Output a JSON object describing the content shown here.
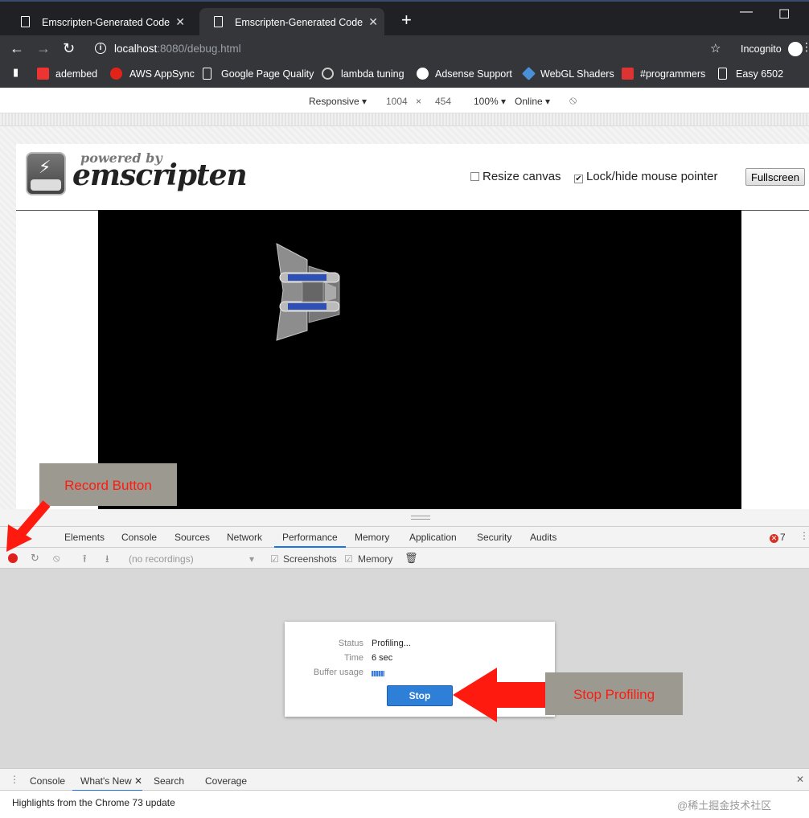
{
  "tabs": [
    {
      "title": "Emscripten-Generated Code",
      "close": "✕"
    },
    {
      "title": "Emscripten-Generated Code",
      "close": "✕"
    }
  ],
  "window": {
    "minimize": "—",
    "maximize": "☐"
  },
  "address": {
    "host": "localhost",
    "rest": ":8080/debug.html"
  },
  "incognito_label": "Incognito",
  "bookmarks": [
    "adembed",
    "AWS AppSync",
    "Google Page Quality",
    "lambda tuning",
    "Adsense Support",
    "WebGL Shaders",
    "#programmers",
    "Easy 6502"
  ],
  "device_toolbar": {
    "mode": "Responsive ▾",
    "width": "1004",
    "times": "×",
    "height": "454",
    "zoom": "100% ▾",
    "network": "Online ▾"
  },
  "page": {
    "powered_by": "powered by",
    "brand": "emscripten",
    "resize_canvas": "Resize canvas",
    "lock_pointer": "Lock/hide mouse pointer",
    "fullscreen": "Fullscreen"
  },
  "devtools": {
    "tabs": [
      "Elements",
      "Console",
      "Sources",
      "Network",
      "Performance",
      "Memory",
      "Application",
      "Security",
      "Audits"
    ],
    "selected_tab": "Performance",
    "error_count": "7",
    "recordings_placeholder": "(no recordings)",
    "screenshots": "Screenshots",
    "memory": "Memory"
  },
  "profiling": {
    "status_label": "Status",
    "status_value": "Profiling...",
    "time_label": "Time",
    "time_value": "6 sec",
    "buffer_label": "Buffer usage",
    "stop": "Stop"
  },
  "drawer": {
    "tabs": [
      "Console",
      "What's New",
      "Search",
      "Coverage"
    ],
    "selected_tab": "What's New",
    "content": "Highlights from the Chrome 73 update"
  },
  "annotations": {
    "record_button": "Record Button",
    "stop_profiling": "Stop Profiling"
  },
  "watermark": "@稀土掘金技术社区",
  "colors": {
    "accent": "#1a73e8",
    "record": "#e0201c",
    "arrow": "#ff1a0f",
    "callout_bg": "#9c9a90"
  }
}
